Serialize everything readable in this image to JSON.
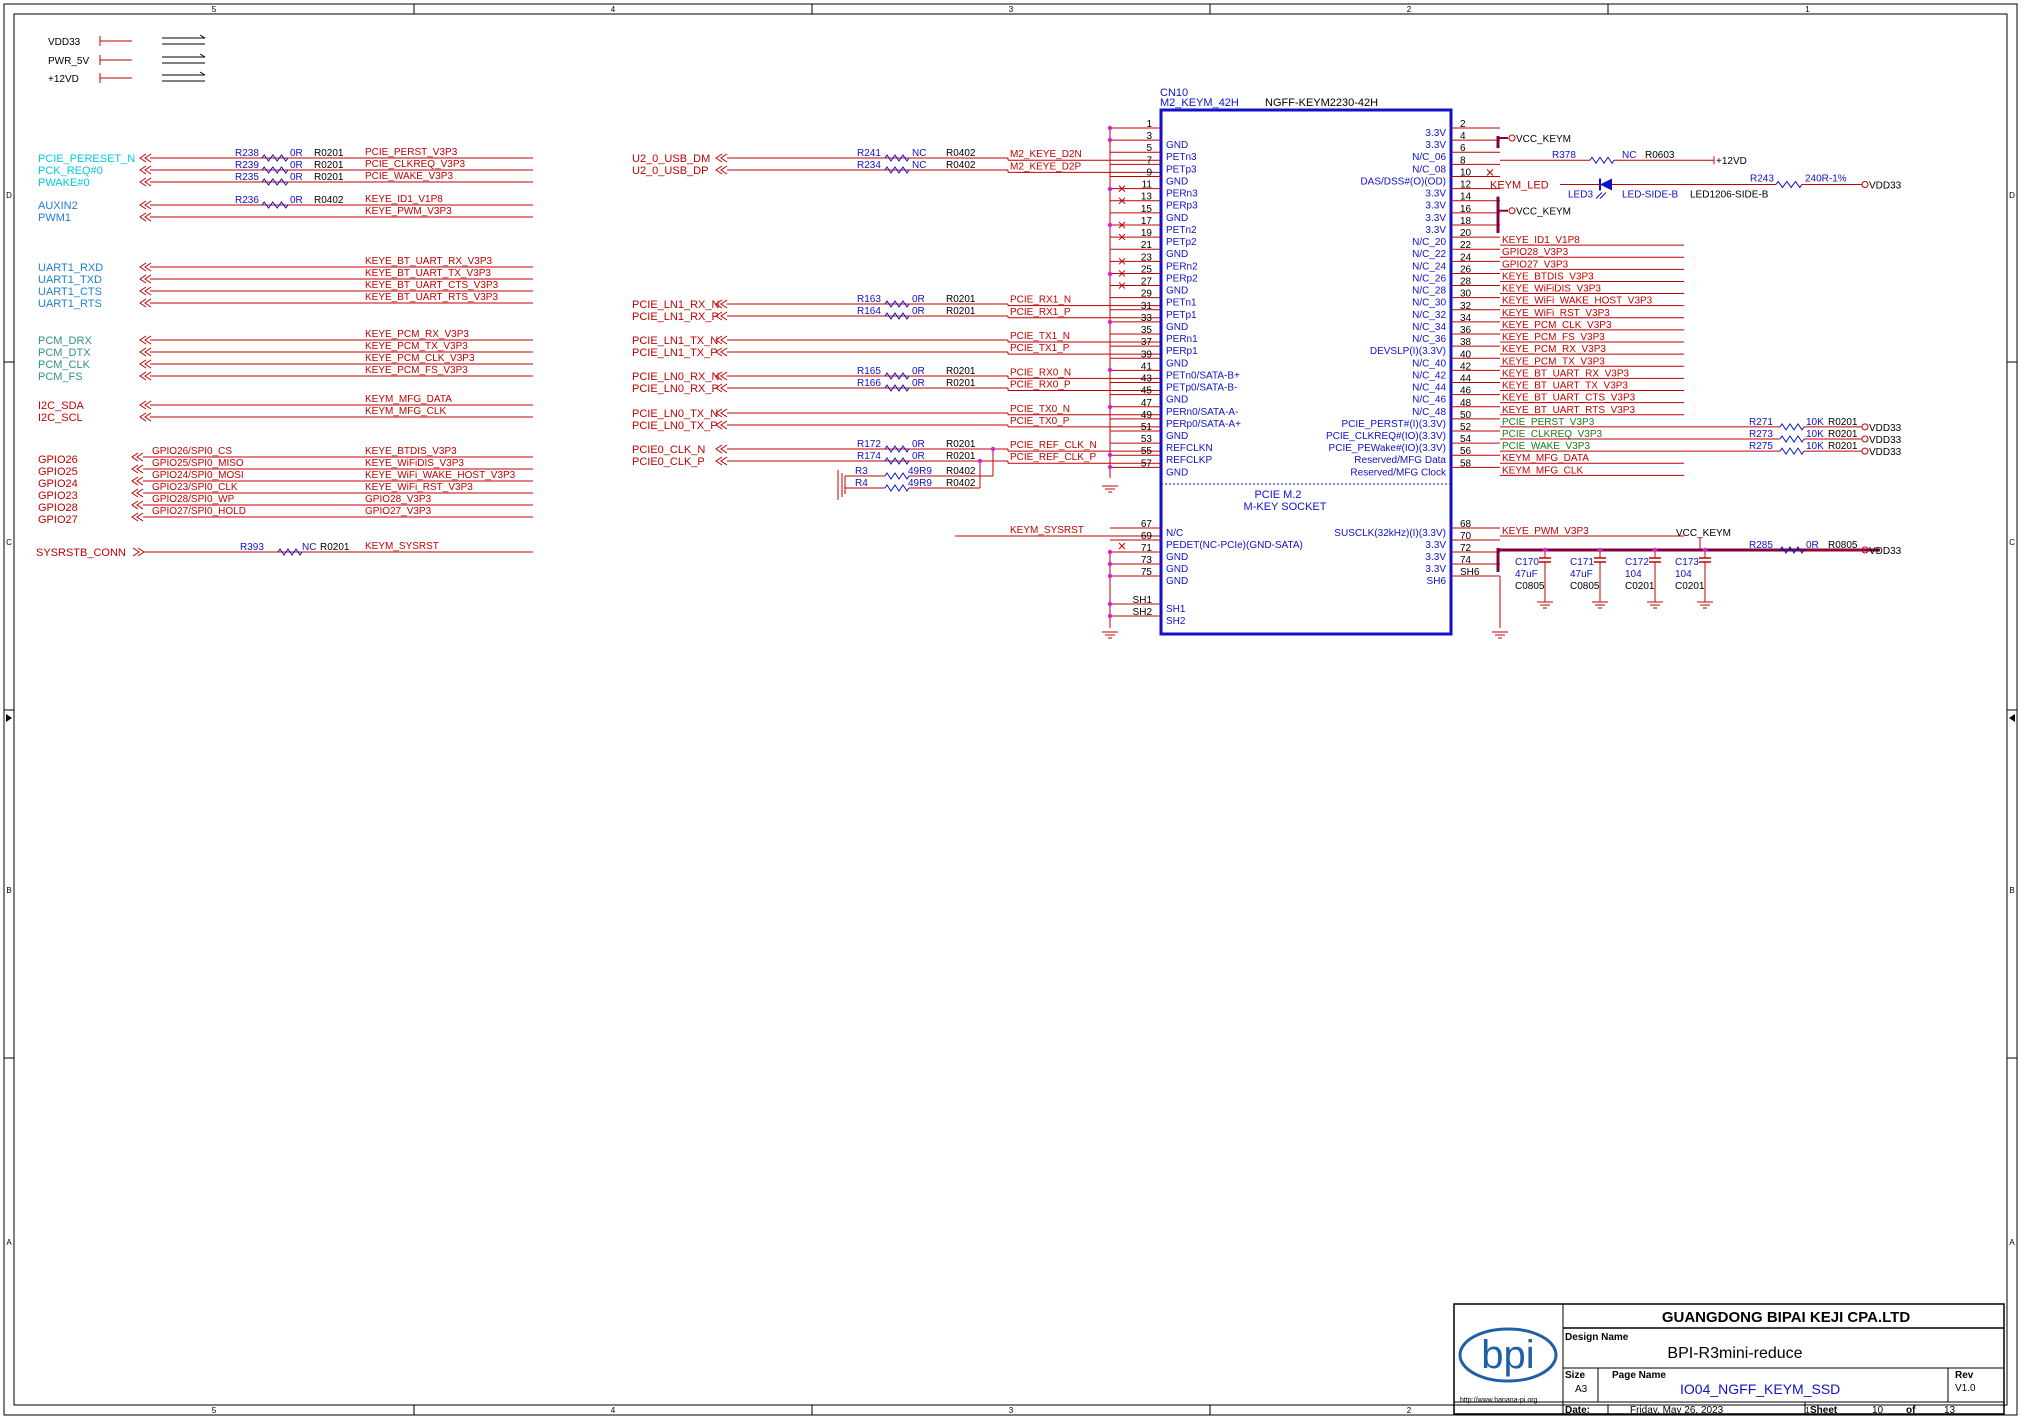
{
  "border": {
    "cols": [
      "5",
      "4",
      "3",
      "2",
      "1"
    ],
    "rows": [
      "D",
      "C",
      "B",
      "A"
    ]
  },
  "power_symbols": [
    "VDD33",
    "PWR_5V",
    "+12VD"
  ],
  "left_groups": {
    "pcie_ports": [
      "PCIE_PERESET_N",
      "PCK_REQ#0",
      "PWAKE#0"
    ],
    "aux_ports": [
      "AUXIN2",
      "PWM1"
    ],
    "uart_ports": [
      "UART1_RXD",
      "UART1_TXD",
      "UART1_CTS",
      "UART1_RTS"
    ],
    "pcm_ports": [
      "PCM_DRX",
      "PCM_DTX",
      "PCM_CLK",
      "PCM_FS"
    ],
    "i2c_ports": [
      "I2C_SDA",
      "I2C_SCL"
    ],
    "gpio_ports": [
      "GPIO26",
      "GPIO25",
      "GPIO24",
      "GPIO23",
      "GPIO28",
      "GPIO27"
    ],
    "gpio_functions": [
      "GPIO26/SPI0_CS",
      "GPIO25/SPI0_MISO",
      "GPIO24/SPI0_MOSI",
      "GPIO23/SPI0_CLK",
      "GPIO28/SPI0_WP",
      "GPIO27/SPI0_HOLD"
    ],
    "sysrst_port": "SYSRSTB_CONN"
  },
  "left_nets": {
    "pcie": [
      "PCIE_PERST_V3P3",
      "PCIE_CLKREQ_V3P3",
      "PCIE_WAKE_V3P3"
    ],
    "aux": [
      "KEYE_ID1_V1P8",
      "KEYE_PWM_V3P3"
    ],
    "uart": [
      "KEYE_BT_UART_RX_V3P3",
      "KEYE_BT_UART_TX_V3P3",
      "KEYE_BT_UART_CTS_V3P3",
      "KEYE_BT_UART_RTS_V3P3"
    ],
    "pcm": [
      "KEYE_PCM_RX_V3P3",
      "KEYE_PCM_TX_V3P3",
      "KEYE_PCM_CLK_V3P3",
      "KEYE_PCM_FS_V3P3"
    ],
    "i2c": [
      "KEYM_MFG_DATA",
      "KEYM_MFG_CLK"
    ],
    "gpio": [
      "KEYE_BTDIS_V3P3",
      "KEYE_WiFiDIS_V3P3",
      "KEYE_WiFi_WAKE_HOST_V3P3",
      "KEYE_WiFi_RST_V3P3",
      "GPIO28_V3P3",
      "GPIO27_V3P3"
    ],
    "sysrst": "KEYM_SYSRST"
  },
  "left_resistors": [
    {
      "ref": "R238",
      "val": "0R",
      "pkg": "R0201"
    },
    {
      "ref": "R239",
      "val": "0R",
      "pkg": "R0201"
    },
    {
      "ref": "R235",
      "val": "0R",
      "pkg": "R0201"
    },
    {
      "ref": "R236",
      "val": "0R",
      "pkg": "R0402"
    },
    {
      "ref": "R393",
      "val": "NC",
      "pkg": "R0201"
    }
  ],
  "mid_ports": {
    "usb": [
      "U2_0_USB_DM",
      "U2_0_USB_DP"
    ],
    "ln1_rx": [
      "PCIE_LN1_RX_N",
      "PCIE_LN1_RX_P"
    ],
    "ln1_tx": [
      "PCIE_LN1_TX_N",
      "PCIE_LN1_TX_P"
    ],
    "ln0_rx": [
      "PCIE_LN0_RX_N",
      "PCIE_LN0_RX_P"
    ],
    "ln0_tx": [
      "PCIE_LN0_TX_N",
      "PCIE_LN0_TX_P"
    ],
    "clk": [
      "PCIE0_CLK_N",
      "PCIE0_CLK_P"
    ]
  },
  "mid_nets": {
    "usb": [
      "M2_KEYE_D2N",
      "M2_KEYE_D2P"
    ],
    "ln1_rx": [
      "PCIE_RX1_N",
      "PCIE_RX1_P"
    ],
    "ln1_tx": [
      "PCIE_TX1_N",
      "PCIE_TX1_P"
    ],
    "ln0_rx": [
      "PCIE_RX0_N",
      "PCIE_RX0_P"
    ],
    "ln0_tx": [
      "PCIE_TX0_N",
      "PCIE_TX0_P"
    ],
    "clk": [
      "PCIE_REF_CLK_N",
      "PCIE_REF_CLK_P"
    ],
    "sysrst": "KEYM_SYSRST"
  },
  "mid_resistors": [
    {
      "ref": "R241",
      "val": "NC",
      "pkg": "R0402"
    },
    {
      "ref": "R234",
      "val": "NC",
      "pkg": "R0402"
    },
    {
      "ref": "R163",
      "val": "0R",
      "pkg": "R0201"
    },
    {
      "ref": "R164",
      "val": "0R",
      "pkg": "R0201"
    },
    {
      "ref": "R165",
      "val": "0R",
      "pkg": "R0201"
    },
    {
      "ref": "R166",
      "val": "0R",
      "pkg": "R0201"
    },
    {
      "ref": "R172",
      "val": "0R",
      "pkg": "R0201"
    },
    {
      "ref": "R174",
      "val": "0R",
      "pkg": "R0201"
    },
    {
      "ref": "R3",
      "val": "49R9",
      "pkg": "R0402"
    },
    {
      "ref": "R4",
      "val": "49R9",
      "pkg": "R0402"
    }
  ],
  "connector": {
    "ref": "CN10",
    "name": "M2_KEYM_42H",
    "part": "NGFF-KEYM2230-42H",
    "title1": "PCIE M.2",
    "title2": "M-KEY SOCKET",
    "left_pins": [
      {
        "num": "1",
        "name": ""
      },
      {
        "num": "3",
        "name": "GND"
      },
      {
        "num": "5",
        "name": "PETn3"
      },
      {
        "num": "7",
        "name": "PETp3"
      },
      {
        "num": "9",
        "name": "GND"
      },
      {
        "num": "11",
        "name": "PERn3"
      },
      {
        "num": "13",
        "name": "PERp3"
      },
      {
        "num": "15",
        "name": "GND"
      },
      {
        "num": "17",
        "name": "PETn2"
      },
      {
        "num": "19",
        "name": "PETp2"
      },
      {
        "num": "21",
        "name": "GND"
      },
      {
        "num": "23",
        "name": "PERn2"
      },
      {
        "num": "25",
        "name": "PERp2"
      },
      {
        "num": "27",
        "name": "GND"
      },
      {
        "num": "29",
        "name": "PETn1"
      },
      {
        "num": "31",
        "name": "PETp1"
      },
      {
        "num": "33",
        "name": "GND"
      },
      {
        "num": "35",
        "name": "PERn1"
      },
      {
        "num": "37",
        "name": "PERp1"
      },
      {
        "num": "39",
        "name": "GND"
      },
      {
        "num": "41",
        "name": "PETn0/SATA-B+"
      },
      {
        "num": "43",
        "name": "PETp0/SATA-B-"
      },
      {
        "num": "45",
        "name": "GND"
      },
      {
        "num": "47",
        "name": "PERn0/SATA-A-"
      },
      {
        "num": "49",
        "name": "PERp0/SATA-A+"
      },
      {
        "num": "51",
        "name": "GND"
      },
      {
        "num": "53",
        "name": "REFCLKN"
      },
      {
        "num": "55",
        "name": "REFCLKP"
      },
      {
        "num": "57",
        "name": "GND"
      }
    ],
    "right_pins": [
      {
        "num": "2",
        "name": "3.3V"
      },
      {
        "num": "4",
        "name": "3.3V"
      },
      {
        "num": "6",
        "name": "N/C_06"
      },
      {
        "num": "8",
        "name": "N/C_08"
      },
      {
        "num": "10",
        "name": "DAS/DSS#(O)(OD)"
      },
      {
        "num": "12",
        "name": "3.3V"
      },
      {
        "num": "14",
        "name": "3.3V"
      },
      {
        "num": "16",
        "name": "3.3V"
      },
      {
        "num": "18",
        "name": "3.3V"
      },
      {
        "num": "20",
        "name": "N/C_20"
      },
      {
        "num": "22",
        "name": "N/C_22"
      },
      {
        "num": "24",
        "name": "N/C_24"
      },
      {
        "num": "26",
        "name": "N/C_26"
      },
      {
        "num": "28",
        "name": "N/C_28"
      },
      {
        "num": "30",
        "name": "N/C_30"
      },
      {
        "num": "32",
        "name": "N/C_32"
      },
      {
        "num": "34",
        "name": "N/C_34"
      },
      {
        "num": "36",
        "name": "N/C_36"
      },
      {
        "num": "38",
        "name": "DEVSLP(I)(3.3V)"
      },
      {
        "num": "40",
        "name": "N/C_40"
      },
      {
        "num": "42",
        "name": "N/C_42"
      },
      {
        "num": "44",
        "name": "N/C_44"
      },
      {
        "num": "46",
        "name": "N/C_46"
      },
      {
        "num": "48",
        "name": "N/C_48"
      },
      {
        "num": "50",
        "name": "PCIE_PERST#(I)(3.3V)"
      },
      {
        "num": "52",
        "name": "PCIE_CLKREQ#(IO)(3.3V)"
      },
      {
        "num": "54",
        "name": "PCIE_PEWake#(IO)(3.3V)"
      },
      {
        "num": "56",
        "name": "Reserved/MFG Data"
      },
      {
        "num": "58",
        "name": "Reserved/MFG Clock"
      }
    ],
    "lower_left_pins": [
      {
        "num": "67",
        "name": "N/C"
      },
      {
        "num": "69",
        "name": "PEDET(NC-PCIe)(GND-SATA)"
      },
      {
        "num": "71",
        "name": "GND"
      },
      {
        "num": "73",
        "name": "GND"
      },
      {
        "num": "75",
        "name": "GND"
      },
      {
        "num": "SH1",
        "name": "SH1"
      },
      {
        "num": "SH2",
        "name": "SH2"
      }
    ],
    "lower_right_pins": [
      {
        "num": "68",
        "name": "SUSCLK(32kHz)(I)(3.3V)"
      },
      {
        "num": "70",
        "name": "3.3V"
      },
      {
        "num": "72",
        "name": "3.3V"
      },
      {
        "num": "74",
        "name": "3.3V"
      },
      {
        "num": "SH6",
        "name": "SH6"
      }
    ]
  },
  "right_nets": [
    "KEYE_ID1_V1P8",
    "GPIO28_V3P3",
    "GPIO27_V3P3",
    "KEYE_BTDIS_V3P3",
    "KEYE_WiFiDIS_V3P3",
    "KEYE_WiFi_WAKE_HOST_V3P3",
    "KEYE_WiFi_RST_V3P3",
    "KEYE_PCM_CLK_V3P3",
    "KEYE_PCM_FS_V3P3",
    "KEYE_PCM_RX_V3P3",
    "KEYE_PCM_TX_V3P3",
    "KEYE_BT_UART_RX_V3P3",
    "KEYE_BT_UART_TX_V3P3",
    "KEYE_BT_UART_CTS_V3P3",
    "KEYE_BT_UART_RTS_V3P3"
  ],
  "right_pcie_nets": [
    "PCIE_PERST_V3P3",
    "PCIE_CLKREQ_V3P3",
    "PCIE_WAKE_V3P3"
  ],
  "right_mfg_nets": [
    "KEYM_MFG_DATA",
    "KEYM_MFG_CLK"
  ],
  "right_misc": {
    "vcc1": "VCC_KEYM",
    "vcc2": "VCC_KEYM",
    "r378": {
      "ref": "R378",
      "val": "NC",
      "pkg": "R0603"
    },
    "p12v": "+12VD",
    "led_net": "KEYM_LED",
    "led_ref": "LED3",
    "led_val": "LED-SIDE-B",
    "led_pkg": "LED1206-SIDE-B",
    "r243": {
      "ref": "R243",
      "val": "240R-1%"
    },
    "vdd33": "VDD33",
    "pwm_net": "KEYE_PWM_V3P3",
    "vcc3": "VCC_KEYM",
    "r285": {
      "ref": "R285",
      "val": "0R",
      "pkg": "R0805"
    },
    "pullups": [
      {
        "ref": "R271",
        "val": "10K",
        "pkg": "R0201",
        "pwr": "VDD33"
      },
      {
        "ref": "R273",
        "val": "10K",
        "pkg": "R0201",
        "pwr": "VDD33"
      },
      {
        "ref": "R275",
        "val": "10K",
        "pkg": "R0201",
        "pwr": "VDD33"
      }
    ],
    "caps": [
      {
        "ref": "C170",
        "val": "47uF",
        "pkg": "C0805"
      },
      {
        "ref": "C171",
        "val": "47uF",
        "pkg": "C0805"
      },
      {
        "ref": "C172",
        "val": "104",
        "pkg": "C0201"
      },
      {
        "ref": "C173",
        "val": "104",
        "pkg": "C0201"
      }
    ]
  },
  "title_block": {
    "company": "GUANGDONG BIPAI KEJI CPA.LTD",
    "logo": "bpi",
    "url": "http://www.banana-pi.org",
    "design_name_label": "Design Name",
    "design_name": "BPI-R3mini-reduce",
    "size_label": "Size",
    "size": "A3",
    "page_name_label": "Page Name",
    "page_name": "IO04_NGFF_KEYM_SSD",
    "rev_label": "Rev",
    "rev": "V1.0",
    "date_label": "Date:",
    "date": "Friday, May 26, 2023",
    "sheet_label": "Sheet",
    "sheet": "10",
    "of_label": "of",
    "total": "13"
  },
  "colors": {
    "wire": "#c00000",
    "label_blue": "#1f3fa0",
    "port_cyan": "#00c8e0",
    "port_blue": "#1e7fd0",
    "port_teal": "#2f8f8f",
    "junction": "#e020d0",
    "component": "#1010c8",
    "power_bar": "#800040",
    "green_net": "#1a7a1a"
  }
}
